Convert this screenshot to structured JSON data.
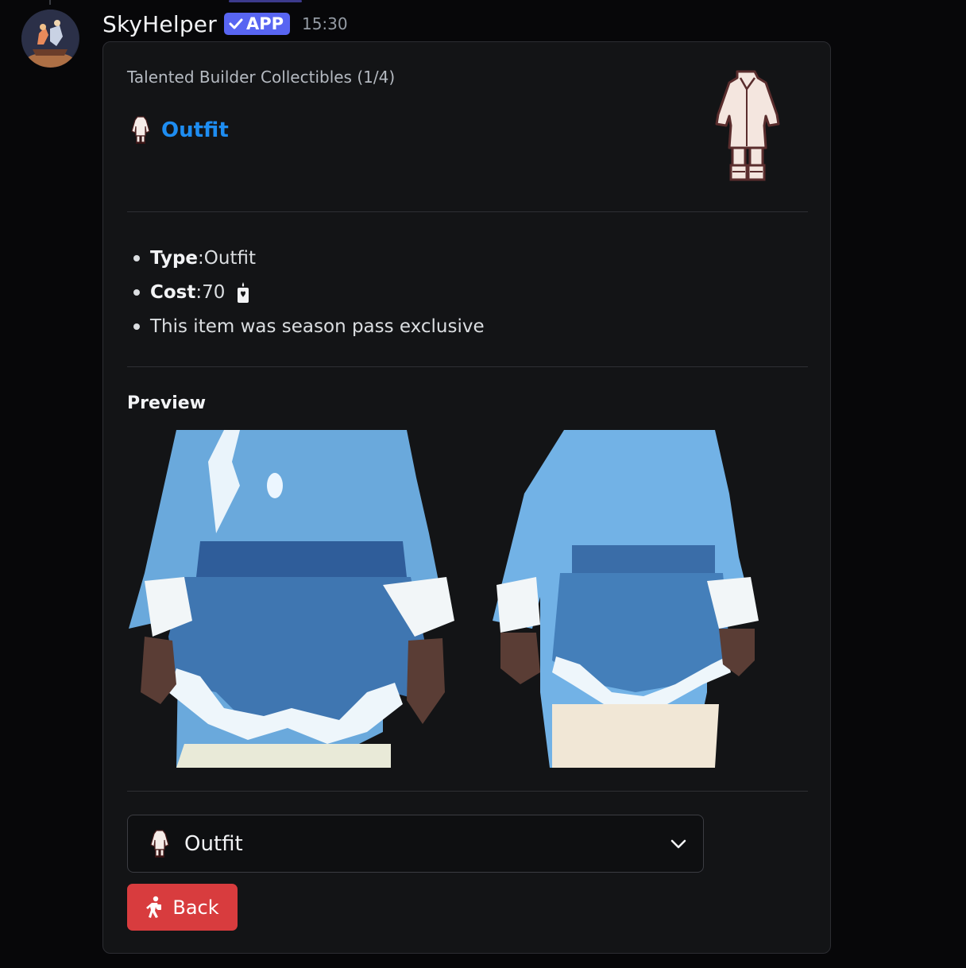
{
  "message": {
    "username": "SkyHelper",
    "badge_label": "APP",
    "timestamp": "15:30"
  },
  "embed": {
    "author": "Talented Builder Collectibles (1/4)",
    "title": "Outfit",
    "fields": [
      {
        "label": "Type",
        "separator": ": ",
        "value": "Outfit"
      },
      {
        "label": "Cost",
        "separator": ": ",
        "value": "70",
        "icon": "candle-icon"
      },
      {
        "text": "This item was season pass exclusive"
      }
    ],
    "preview_heading": "Preview"
  },
  "components": {
    "select": {
      "selected": "Outfit",
      "icon": "outfit-icon"
    },
    "back_button": {
      "label": "Back",
      "icon": "walking-figure-icon",
      "color": "#d83c3e"
    }
  },
  "colors": {
    "link": "#1e8df1",
    "app_badge": "#5865f2",
    "embed_bg": "#131416",
    "page_bg": "#070709"
  }
}
